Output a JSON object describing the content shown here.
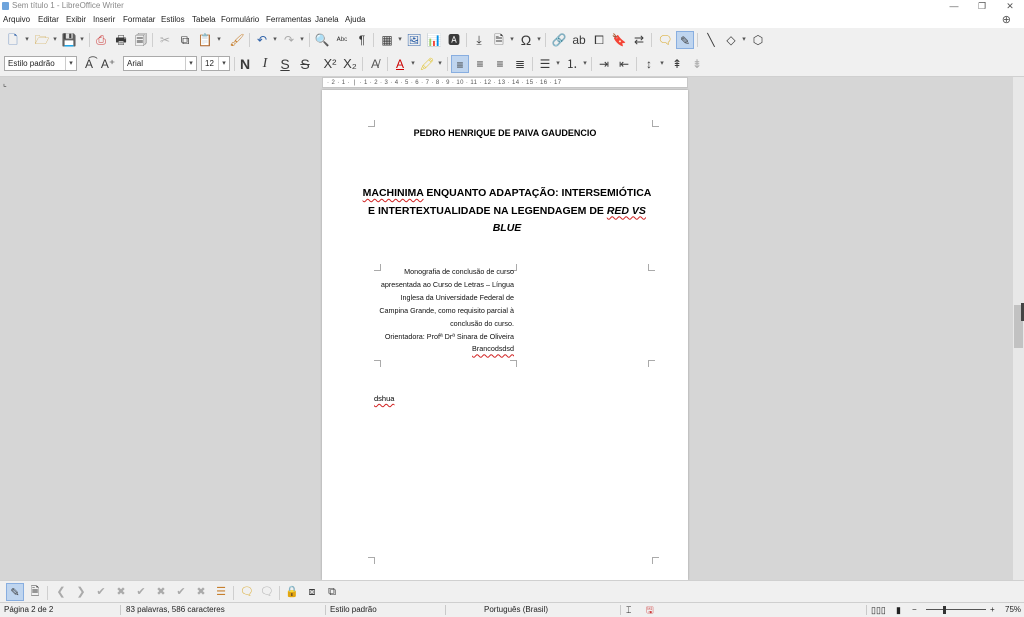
{
  "window": {
    "title": "Sem título 1 - LibreOffice Writer",
    "minimize": "—",
    "restore": "❐",
    "close": "✕"
  },
  "menu": [
    "Arquivo",
    "Editar",
    "Exibir",
    "Inserir",
    "Formatar",
    "Estilos",
    "Tabela",
    "Formulário",
    "Ferramentas",
    "Janela",
    "Ajuda"
  ],
  "toolbar": {
    "paragraph_style": "Estilo padrão",
    "font_name": "Arial",
    "font_size": "12"
  },
  "ruler": {
    "marks": "· 2 · 1 · ❘ · 1 · 2 · 3 · 4 · 5 · 6 · 7 · 8 · 9 · 10 · 11 · 12 · 13 · 14 · 15 · 16 · 17"
  },
  "document": {
    "author": "PEDRO HENRIQUE DE PAIVA GAUDENCIO",
    "title_line1_a": "MACHINIMA",
    "title_line1_b": " ENQUANTO ADAPTAÇÃO: INTERSEMIÓTICA",
    "title_line2": "E INTERTEXTUALIDADE NA LEGENDAGEM DE ",
    "title_line2_italic": "RED VS",
    "title_line3_italic": "BLUE",
    "note_lines": [
      "Monografia de conclusão de curso",
      "apresentada ao Curso de Letras – Língua",
      "Inglesa da Universidade Federal de",
      "Campina Grande, como requisito parcial à",
      "conclusão do curso.",
      "Orientadora: Profª Drª Sinara de Oliveira",
      "Brancodsdsd"
    ],
    "body": "dshua"
  },
  "status": {
    "page": "Página 2 de 2",
    "words": "83 palavras, 586 caracteres",
    "style": "Estilo padrão",
    "language": "Português (Brasil)",
    "zoom": "75%"
  }
}
